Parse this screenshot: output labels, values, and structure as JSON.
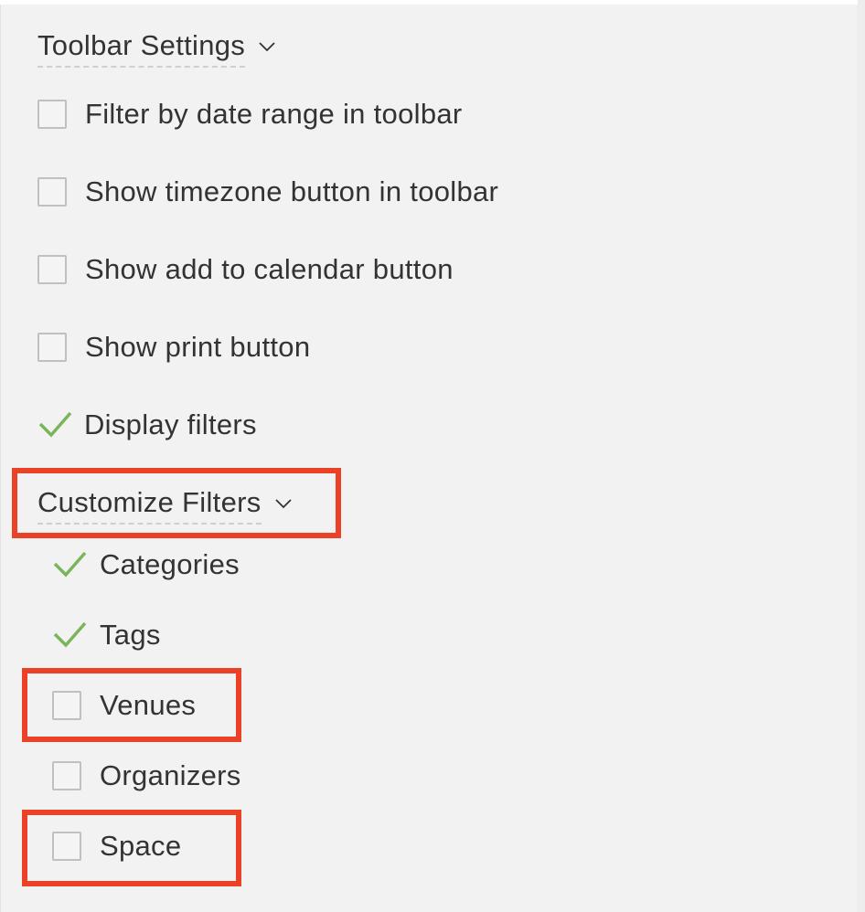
{
  "toolbar_settings": {
    "title": "Toolbar Settings",
    "options": [
      {
        "label": "Filter by date range in toolbar",
        "checked": false
      },
      {
        "label": "Show timezone button in toolbar",
        "checked": false
      },
      {
        "label": "Show add to calendar button",
        "checked": false
      },
      {
        "label": "Show print button",
        "checked": false
      },
      {
        "label": "Display filters",
        "checked": true
      }
    ]
  },
  "customize_filters": {
    "title": "Customize Filters",
    "options": [
      {
        "label": "Categories",
        "checked": true
      },
      {
        "label": "Tags",
        "checked": true
      },
      {
        "label": "Venues",
        "checked": false,
        "highlighted": true
      },
      {
        "label": "Organizers",
        "checked": false
      },
      {
        "label": "Space",
        "checked": false,
        "highlighted": true
      }
    ]
  },
  "icons": {
    "expand": "chevron-down-icon",
    "checked": "checkmark-icon",
    "unchecked": "checkbox-empty"
  },
  "colors": {
    "panel_bg": "#f2f2f2",
    "text": "#333333",
    "check_green": "#7ab55c",
    "checkbox_border": "#bdc1c4",
    "highlight_red": "#ea4127"
  }
}
